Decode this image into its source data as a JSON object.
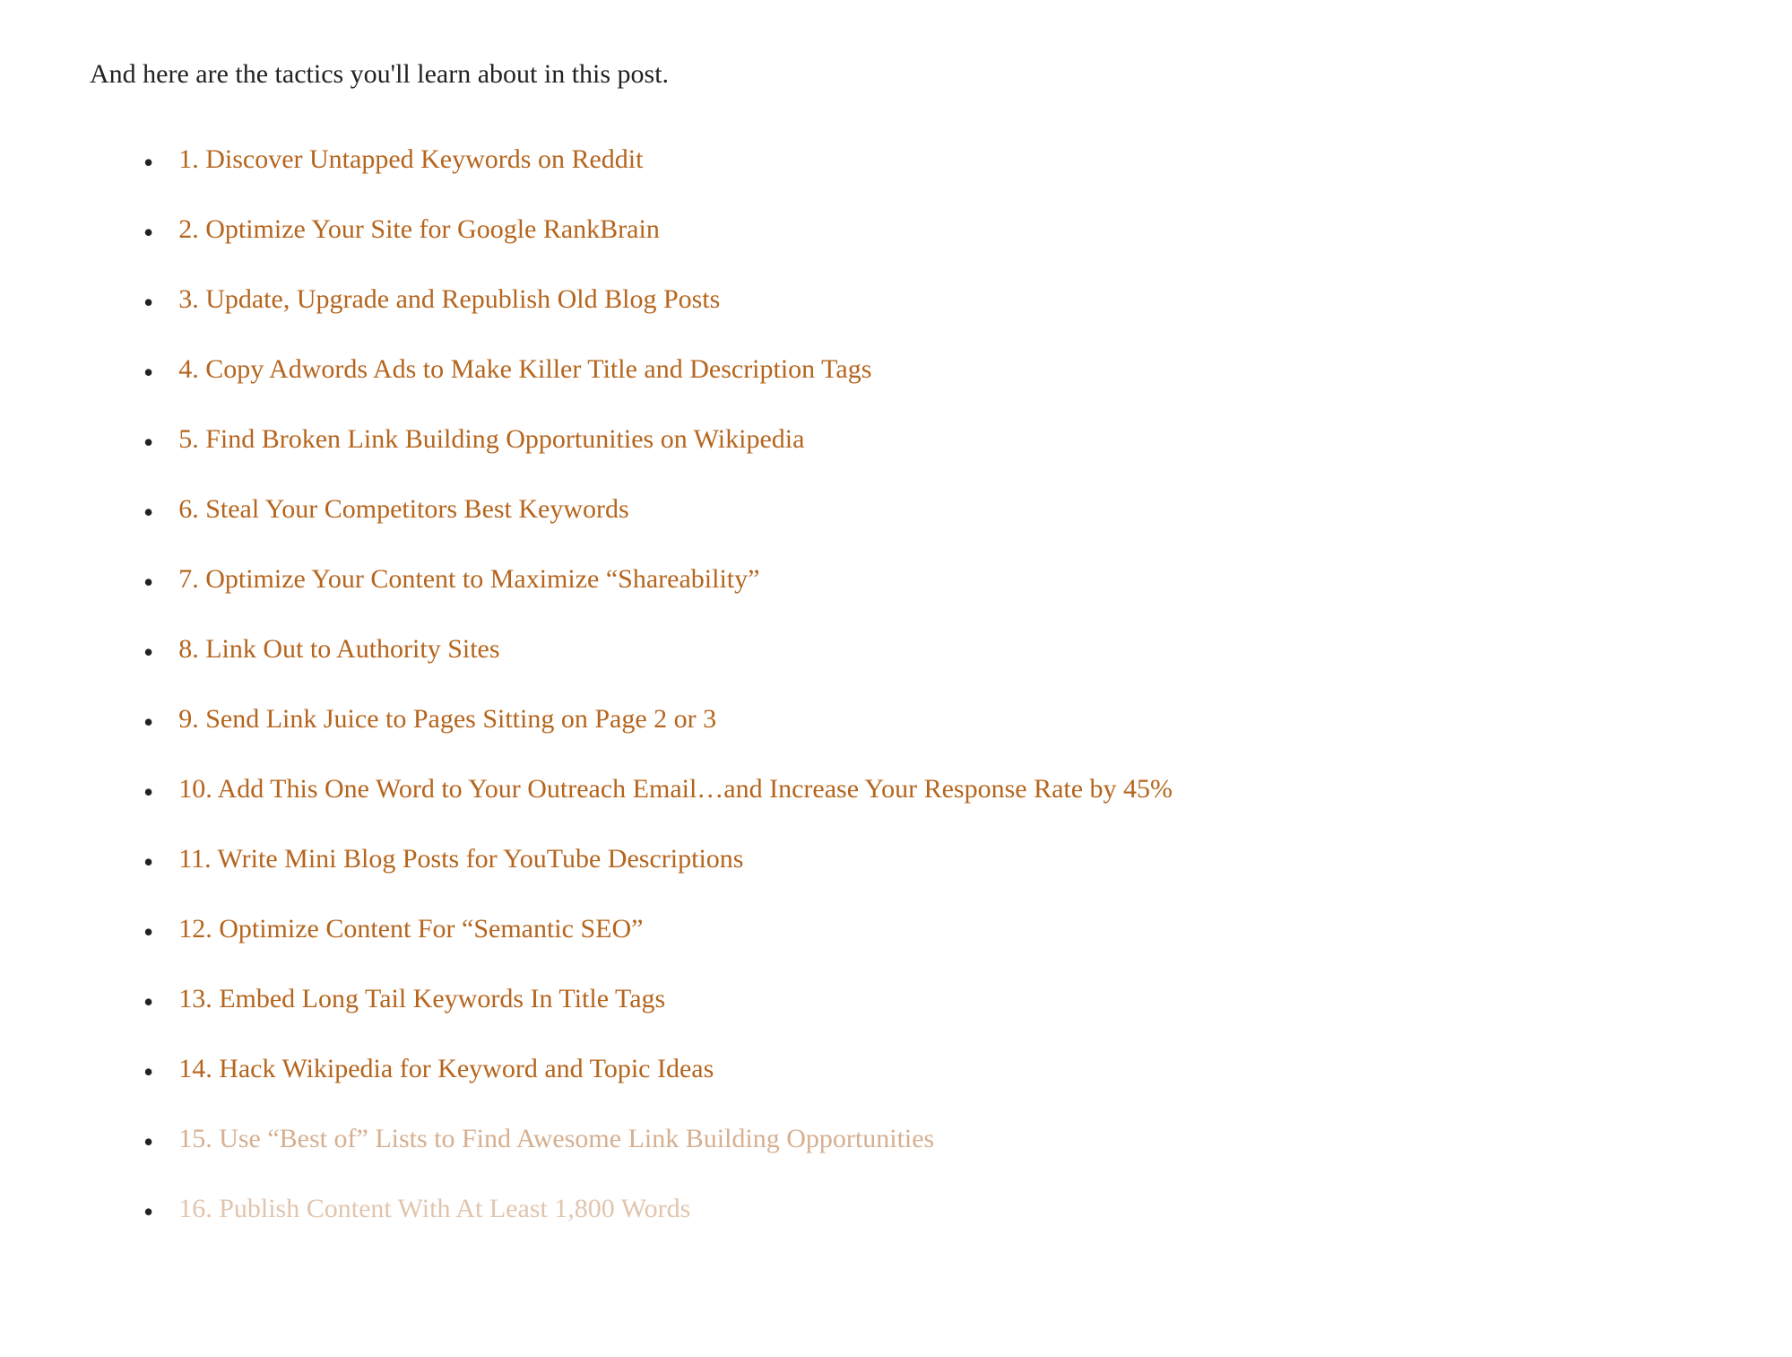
{
  "intro": {
    "text": "And here are the tactics you'll learn about in this post."
  },
  "tactics": [
    {
      "id": 1,
      "label": "1. Discover Untapped Keywords on Reddit",
      "faded": false,
      "very_faded": false
    },
    {
      "id": 2,
      "label": "2. Optimize Your Site for Google RankBrain",
      "faded": false,
      "very_faded": false
    },
    {
      "id": 3,
      "label": "3. Update, Upgrade and Republish Old Blog Posts",
      "faded": false,
      "very_faded": false
    },
    {
      "id": 4,
      "label": "4. Copy Adwords Ads to Make Killer Title and Description Tags",
      "faded": false,
      "very_faded": false
    },
    {
      "id": 5,
      "label": "5. Find Broken Link Building Opportunities on Wikipedia",
      "faded": false,
      "very_faded": false
    },
    {
      "id": 6,
      "label": "6. Steal Your Competitors Best Keywords",
      "faded": false,
      "very_faded": false
    },
    {
      "id": 7,
      "label": "7. Optimize Your Content to Maximize “Shareability”",
      "faded": false,
      "very_faded": false
    },
    {
      "id": 8,
      "label": "8. Link Out to Authority Sites",
      "faded": false,
      "very_faded": false
    },
    {
      "id": 9,
      "label": "9. Send Link Juice to Pages Sitting on Page 2 or 3",
      "faded": false,
      "very_faded": false
    },
    {
      "id": 10,
      "label": "10. Add This One Word to Your Outreach Email…and Increase Your Response Rate by 45%",
      "faded": false,
      "very_faded": false
    },
    {
      "id": 11,
      "label": "11. Write Mini Blog Posts for YouTube Descriptions",
      "faded": false,
      "very_faded": false
    },
    {
      "id": 12,
      "label": "12. Optimize Content For “Semantic SEO”",
      "faded": false,
      "very_faded": false
    },
    {
      "id": 13,
      "label": "13. Embed Long Tail Keywords In Title Tags",
      "faded": false,
      "very_faded": false
    },
    {
      "id": 14,
      "label": "14. Hack Wikipedia for Keyword and Topic Ideas",
      "faded": false,
      "very_faded": false
    },
    {
      "id": 15,
      "label": "15. Use “Best of” Lists to Find Awesome Link Building Opportunities",
      "faded": true,
      "very_faded": false
    },
    {
      "id": 16,
      "label": "16. Publish Content With At Least 1,800 Words",
      "faded": true,
      "very_faded": true
    }
  ],
  "bullet_symbol": "•"
}
